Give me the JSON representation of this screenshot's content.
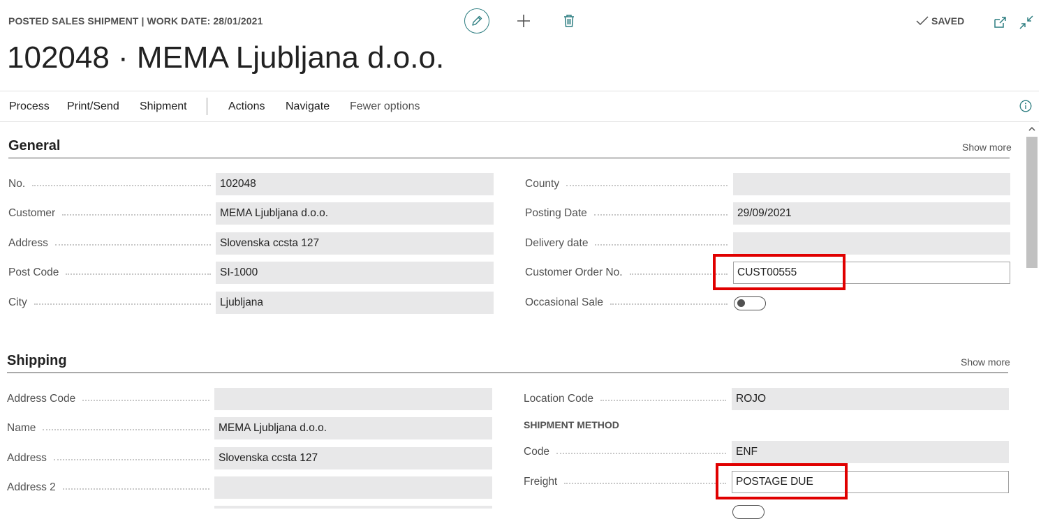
{
  "header": {
    "caption": "POSTED SALES SHIPMENT | WORK DATE: 28/01/2021",
    "title": "102048 · MEMA Ljubljana d.o.o.",
    "status": "SAVED"
  },
  "actions": {
    "process": "Process",
    "print_send": "Print/Send",
    "shipment": "Shipment",
    "actions": "Actions",
    "navigate": "Navigate",
    "fewer_options": "Fewer options"
  },
  "general": {
    "title": "General",
    "show_more": "Show more",
    "left": [
      {
        "label": "No.",
        "value": "102048"
      },
      {
        "label": "Customer",
        "value": "MEMA Ljubljana d.o.o."
      },
      {
        "label": "Address",
        "value": "Slovenska ccsta 127"
      },
      {
        "label": "Post Code",
        "value": "SI-1000"
      },
      {
        "label": "City",
        "value": "Ljubljana"
      }
    ],
    "right": [
      {
        "label": "County",
        "value": ""
      },
      {
        "label": "Posting Date",
        "value": "29/09/2021"
      },
      {
        "label": "Delivery date",
        "value": ""
      },
      {
        "label": "Customer Order No.",
        "value": "CUST00555"
      },
      {
        "label": "Occasional Sale",
        "value": "off"
      }
    ]
  },
  "shipping": {
    "title": "Shipping",
    "show_more": "Show more",
    "left": [
      {
        "label": "Address Code",
        "value": ""
      },
      {
        "label": "Name",
        "value": "MEMA Ljubljana d.o.o."
      },
      {
        "label": "Address",
        "value": "Slovenska ccsta 127"
      },
      {
        "label": "Address 2",
        "value": ""
      }
    ],
    "right": {
      "location_code": {
        "label": "Location Code",
        "value": "ROJO"
      },
      "shipment_method_heading": "SHIPMENT METHOD",
      "code": {
        "label": "Code",
        "value": "ENF"
      },
      "freight": {
        "label": "Freight",
        "value": "POSTAGE DUE"
      }
    }
  },
  "colors": {
    "accent": "#2c7d80",
    "highlight": "#e00000",
    "field_bg": "#e8e8e9"
  }
}
